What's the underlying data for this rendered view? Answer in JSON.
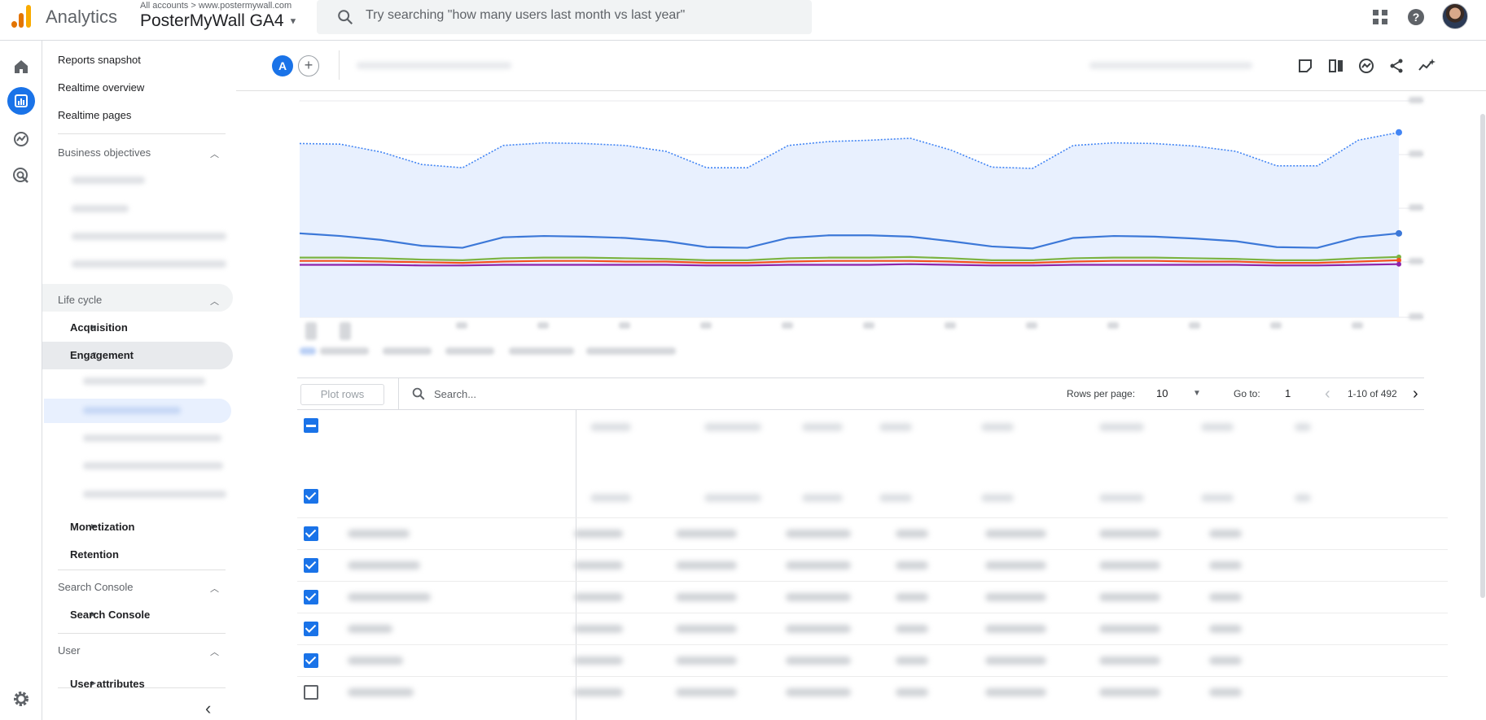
{
  "topbar": {
    "app_name": "Analytics",
    "breadcrumb_all": "All accounts",
    "breadcrumb_sep": ">",
    "breadcrumb_site": "www.postermywall.com",
    "property": "PosterMyWall GA4",
    "search_placeholder": "Try searching \"how many users last month vs last year\""
  },
  "nav": {
    "reports_snapshot": "Reports snapshot",
    "realtime_overview": "Realtime overview",
    "realtime_pages": "Realtime pages",
    "business_objectives": "Business objectives",
    "life_cycle": "Life cycle",
    "acquisition": "Acquisition",
    "engagement": "Engagement",
    "monetization": "Monetization",
    "retention": "Retention",
    "search_console_section": "Search Console",
    "search_console_item": "Search Console",
    "user_section": "User",
    "user_attributes": "User attributes"
  },
  "toolbar": {
    "comparison_chip": "A",
    "add_comparison": "+"
  },
  "table": {
    "plot_rows": "Plot rows",
    "search_placeholder": "Search...",
    "rows_per_page_label": "Rows per page:",
    "rows_per_page_value": "10",
    "goto_label": "Go to:",
    "goto_value": "1",
    "range": "1-10 of 492",
    "checkbox_states": [
      "indeterminate",
      "checked",
      "checked",
      "checked",
      "checked",
      "checked",
      "checked",
      "unchecked"
    ]
  },
  "colors": {
    "accent": "#1a73e8",
    "area_fill": "#e8f0fe",
    "series_total": "#4285f4",
    "series_2": "#3c78d8",
    "series_3": "#7cb342",
    "series_4": "#f4511e",
    "series_5": "#8e24aa"
  },
  "chart_data": {
    "type": "line",
    "x": [
      0,
      1,
      2,
      3,
      4,
      5,
      6,
      7,
      8,
      9,
      10,
      11,
      12,
      13,
      14,
      15,
      16,
      17,
      18,
      19,
      20,
      21,
      22,
      23,
      24,
      25,
      26,
      27
    ],
    "series": [
      {
        "values": [
          265,
          264,
          252,
          233,
          228,
          262,
          266,
          265,
          262,
          253,
          228,
          228,
          262,
          268,
          270,
          273,
          255,
          229,
          227,
          262,
          266,
          265,
          261,
          253,
          231,
          231,
          270,
          282
        ]
      },
      {
        "values": [
          128,
          124,
          118,
          109,
          106,
          122,
          124,
          123,
          121,
          116,
          107,
          106,
          121,
          125,
          125,
          123,
          116,
          108,
          105,
          121,
          124,
          123,
          120,
          116,
          107,
          106,
          122,
          128
        ]
      },
      {
        "values": [
          91,
          91,
          90,
          88,
          87,
          90,
          91,
          91,
          90,
          89,
          87,
          87,
          90,
          91,
          91,
          92,
          90,
          87,
          87,
          90,
          91,
          91,
          90,
          89,
          87,
          87,
          90,
          92
        ]
      },
      {
        "values": [
          86,
          86,
          85,
          84,
          83,
          85,
          86,
          86,
          85,
          85,
          83,
          83,
          85,
          86,
          86,
          86,
          85,
          83,
          83,
          85,
          86,
          86,
          85,
          85,
          83,
          83,
          85,
          87
        ]
      },
      {
        "values": [
          80,
          80,
          80,
          79,
          79,
          80,
          80,
          80,
          80,
          80,
          79,
          79,
          80,
          80,
          80,
          81,
          80,
          79,
          79,
          80,
          80,
          80,
          80,
          80,
          79,
          79,
          80,
          81
        ]
      }
    ]
  }
}
